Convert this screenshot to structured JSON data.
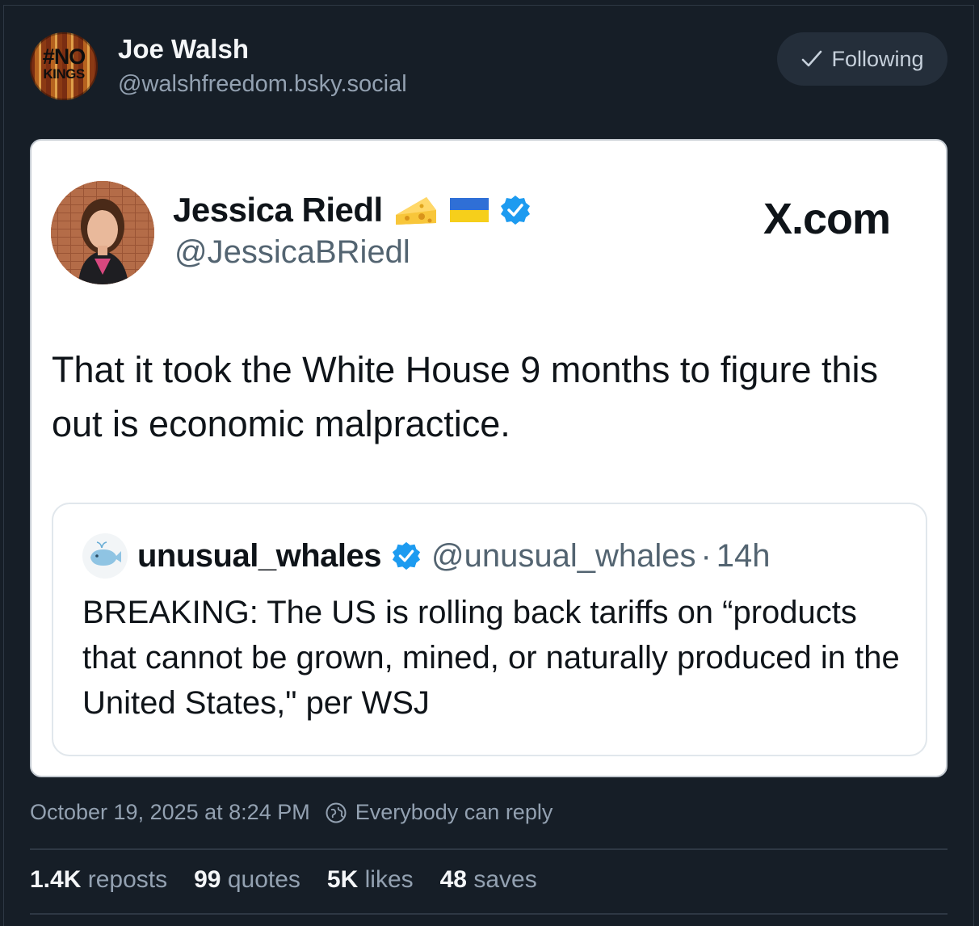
{
  "author": {
    "avatar_text_top": "#NO",
    "avatar_text_bottom": "KINGS",
    "name": "Joe Walsh",
    "handle": "@walshfreedom.bsky.social",
    "follow_label": "Following"
  },
  "embedded_post": {
    "author_name": "Jessica Riedl",
    "author_handle": "@JessicaBRiedl",
    "source_label": "X.com",
    "body": "That it took the White House 9 months to figure this out is economic malpractice.",
    "quoted": {
      "name": "unusual_whales",
      "handle": "@unusual_whales",
      "separator": "·",
      "time": "14h",
      "body": "BREAKING: The US is rolling back tariffs on “products that cannot be grown, mined, or naturally produced in the United States,\" per WSJ"
    }
  },
  "meta": {
    "timestamp": "October 19, 2025 at 8:24 PM",
    "reply_permission": "Everybody can reply"
  },
  "stats": {
    "reposts_count": "1.4K",
    "reposts_label": "reposts",
    "quotes_count": "99",
    "quotes_label": "quotes",
    "likes_count": "5K",
    "likes_label": "likes",
    "saves_count": "48",
    "saves_label": "saves"
  },
  "colors": {
    "background": "#161e27",
    "muted_text": "#93a1b1",
    "verified_blue": "#1d9bf0",
    "follow_button": "#242e3a"
  }
}
